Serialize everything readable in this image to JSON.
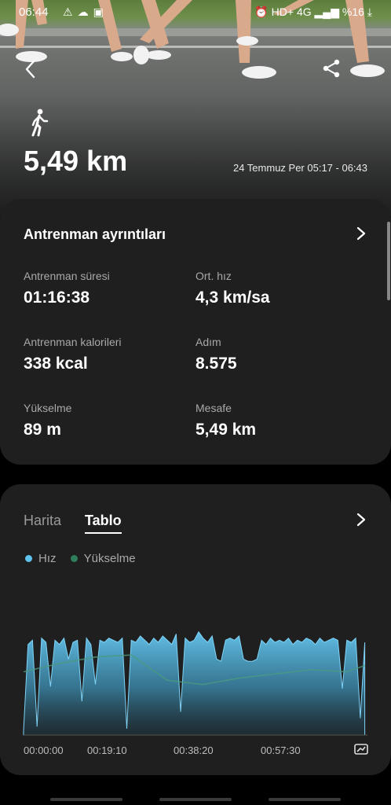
{
  "status_bar": {
    "time": "06:44",
    "left_icons": [
      "warning-icon",
      "cloud-icon",
      "image-icon"
    ],
    "network": "HD+ 4G",
    "battery": "%16"
  },
  "header": {
    "activity_icon": "walking-icon",
    "distance": "5,49 km",
    "datetime": "24 Temmuz Per 05:17 - 06:43"
  },
  "details": {
    "title": "Antrenman ayrıntıları",
    "stats": [
      {
        "label": "Antrenman süresi",
        "value": "01:16:38"
      },
      {
        "label": "Ort. hız",
        "value": "4,3 km/sa"
      },
      {
        "label": "Antrenman kalorileri",
        "value": "338 kcal"
      },
      {
        "label": "Adım",
        "value": "8.575"
      },
      {
        "label": "Yükselme",
        "value": "89 m"
      },
      {
        "label": "Mesafe",
        "value": "5,49 km"
      }
    ]
  },
  "chart_card": {
    "tabs": [
      "Harita",
      "Tablo"
    ],
    "active_tab": "Tablo",
    "legend": [
      {
        "name": "Hız",
        "color": "#5ec3ef"
      },
      {
        "name": "Yükselme",
        "color": "#2e7d5b"
      }
    ]
  },
  "chart_data": {
    "type": "area",
    "x_tick_labels": [
      "00:00:00",
      "00:19:10",
      "00:38:20",
      "00:57:30"
    ],
    "x_range_minutes": [
      0,
      76.6
    ],
    "series": [
      {
        "name": "Hız",
        "color": "#5ec3ef",
        "x_minutes": [
          0,
          1,
          2,
          3,
          4,
          5,
          6,
          7,
          8,
          9,
          10,
          11,
          12,
          13,
          14,
          15,
          16,
          17,
          18,
          19,
          20,
          21,
          22,
          23,
          24,
          25,
          26,
          27,
          28,
          29,
          30,
          31,
          32,
          33,
          34,
          35,
          36,
          37,
          38,
          39,
          40,
          41,
          42,
          43,
          44,
          45,
          46,
          47,
          48,
          49,
          50,
          51,
          52,
          53,
          54,
          55,
          56,
          57,
          58,
          59,
          60,
          61,
          62,
          63,
          64,
          65,
          66,
          67,
          68,
          69,
          70,
          71,
          72,
          73,
          74,
          75,
          76
        ],
        "values": [
          0.2,
          4.3,
          4.5,
          0.4,
          4.6,
          4.4,
          2.3,
          4.5,
          4.3,
          4.6,
          3.6,
          4.4,
          4.5,
          1.6,
          4.6,
          4.3,
          2.4,
          4.5,
          4.4,
          4.6,
          4.5,
          4.4,
          4.6,
          0.3,
          4.5,
          4.4,
          4.7,
          4.5,
          4.3,
          4.6,
          4.4,
          4.7,
          4.5,
          4.3,
          4.8,
          1.1,
          4.6,
          4.4,
          4.5,
          4.9,
          4.6,
          4.4,
          4.7,
          3.6,
          3.5,
          4.5,
          4.6,
          4.5,
          4.7,
          3.6,
          3.5,
          3.5,
          3.6,
          4.5,
          4.3,
          4.6,
          4.4,
          4.5,
          4.4,
          4.6,
          4.3,
          4.5,
          4.4,
          4.6,
          4.5,
          4.3,
          4.6,
          4.4,
          4.5,
          4.6,
          4.5,
          2.2,
          4.5,
          4.4,
          4.6,
          0.8,
          4.4
        ]
      },
      {
        "name": "Yükselme",
        "color": "#2e7d5b",
        "x_minutes": [
          0,
          8,
          16,
          24,
          32,
          40,
          48,
          56,
          64,
          72,
          76
        ],
        "values": [
          60,
          68,
          74,
          76,
          52,
          48,
          54,
          58,
          62,
          60,
          66
        ]
      }
    ]
  },
  "nav": {
    "back_icon": "back-arrow-icon",
    "share_icon": "share-icon",
    "chevron_icon": "chevron-right-icon",
    "expand_icon": "expand-chart-icon"
  }
}
